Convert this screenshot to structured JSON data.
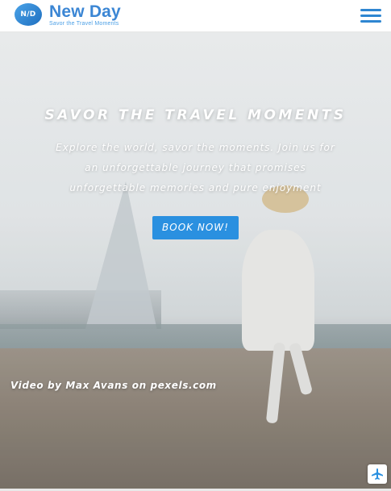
{
  "brand": {
    "badge": "N/D",
    "name": "New Day",
    "tagline": "Savor the Travel Moments"
  },
  "navbar": {
    "menu_icon": "hamburger-menu-icon"
  },
  "hero": {
    "title": "SAVOR THE TRAVEL MOMENTS",
    "text": "Explore the world, savor the moments. Join us for an unforgettable journey that promises unforgettable memories and pure enjoyment",
    "button_label": "BOOK NOW!",
    "credit_prefix": "Video by",
    "credit_author": "Max Avans",
    "credit_on": "on",
    "credit_site": "pexels.com"
  },
  "scroll_button": {
    "icon": "airplane-icon"
  },
  "colors": {
    "accent": "#2a90e0",
    "brand_blue": "#3b86d4",
    "menu_icon": "#2e86d1",
    "hero_text": "#ffffff"
  }
}
